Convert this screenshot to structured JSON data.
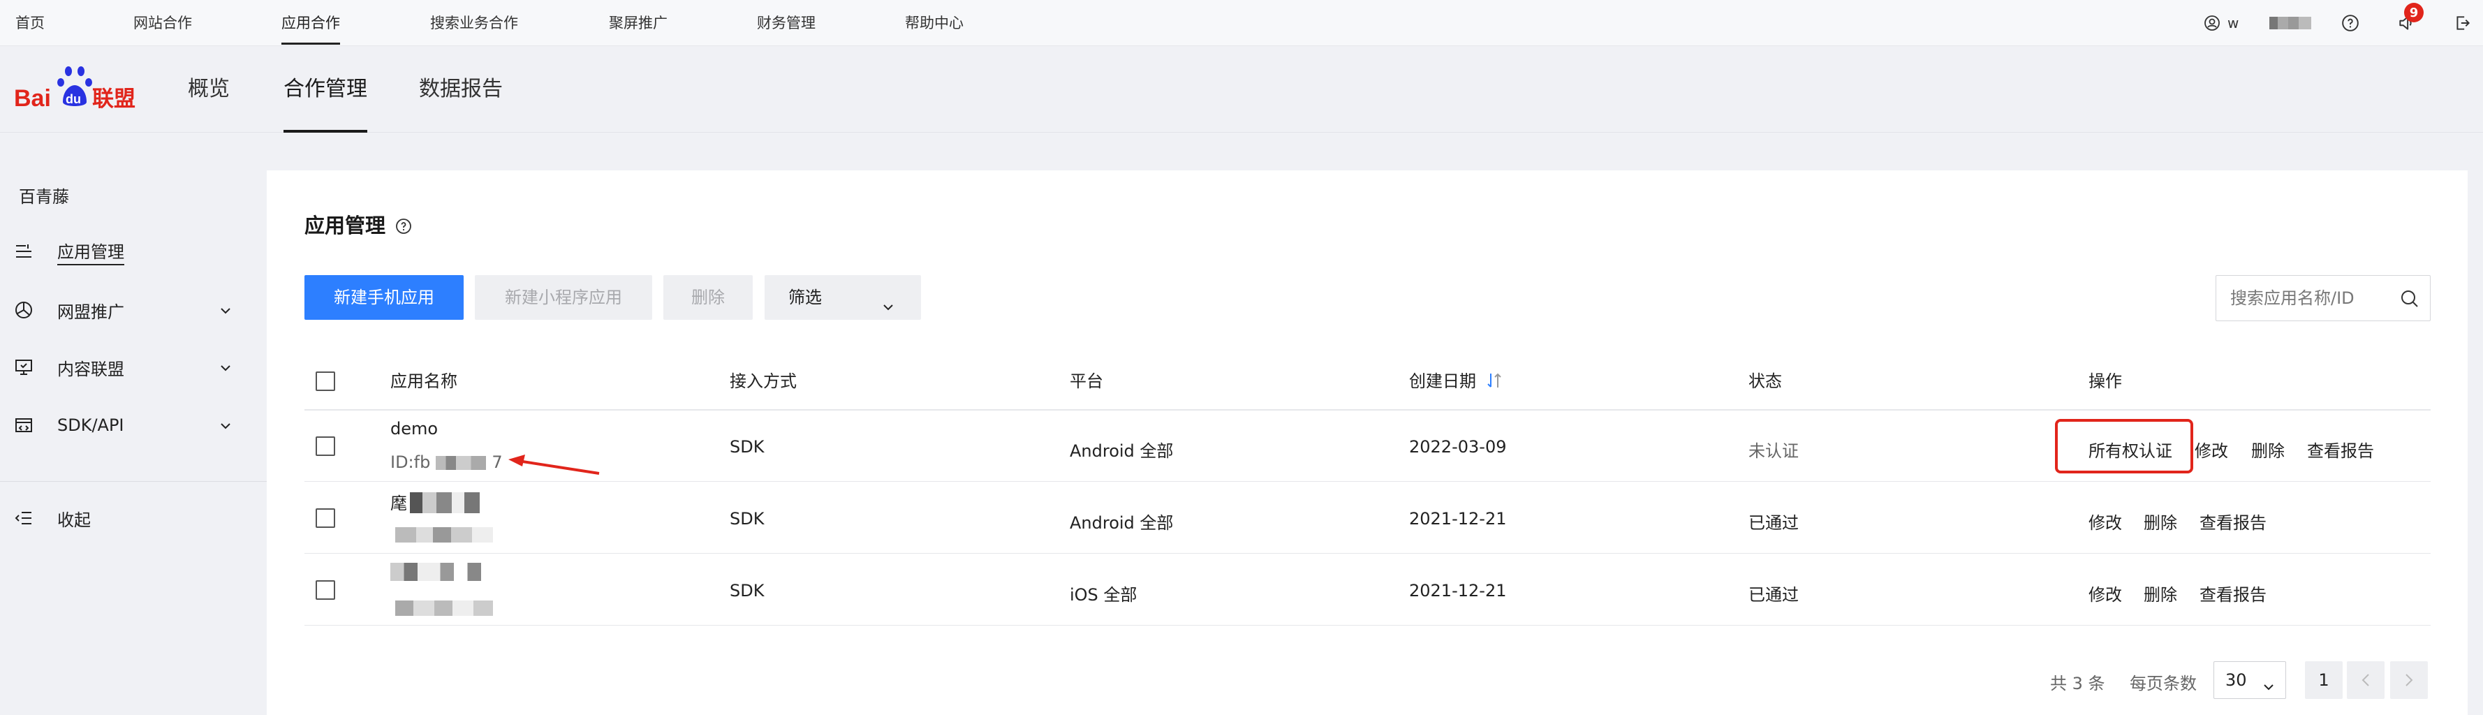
{
  "topnav": {
    "items": [
      "首页",
      "网站合作",
      "应用合作",
      "搜索业务合作",
      "聚屏推广",
      "财务管理",
      "帮助中心"
    ],
    "active_index": 2,
    "user_name": "w",
    "notification_count": "9"
  },
  "header": {
    "logo_text": "Bai du 联盟",
    "logo_bai": "Bai",
    "logo_du": "du",
    "logo_lianmeng": "联盟",
    "tabs": [
      "概览",
      "合作管理",
      "数据报告"
    ],
    "active_tab": 1
  },
  "sidebar": {
    "title": "百青藤",
    "items": [
      {
        "label": "应用管理",
        "icon": "list-icon",
        "has_chevron": false,
        "active": true
      },
      {
        "label": "网盟推广",
        "icon": "chart-icon",
        "has_chevron": true,
        "active": false
      },
      {
        "label": "内容联盟",
        "icon": "monitor-icon",
        "has_chevron": true,
        "active": false
      },
      {
        "label": "SDK/API",
        "icon": "sdk-icon",
        "has_chevron": true,
        "active": false
      }
    ],
    "collapse_label": "收起"
  },
  "main": {
    "title": "应用管理",
    "buttons": {
      "new_app": "新建手机应用",
      "new_mini": "新建小程序应用",
      "delete": "删除",
      "filter": "筛选"
    },
    "search_placeholder": "搜索应用名称/ID",
    "table": {
      "columns": [
        "应用名称",
        "接入方式",
        "平台",
        "创建日期",
        "状态",
        "操作"
      ],
      "rows": [
        {
          "name": "demo",
          "id_prefix": "ID:fb",
          "id_suffix": "7",
          "access": "SDK",
          "platform": "Android 全部",
          "date": "2022-03-09",
          "status": "未认证",
          "actions": [
            "所有权认证",
            "修改",
            "删除",
            "查看报告"
          ]
        },
        {
          "name": "麾",
          "access": "SDK",
          "platform": "Android 全部",
          "date": "2021-12-21",
          "status": "已通过",
          "actions": [
            "修改",
            "删除",
            "查看报告"
          ]
        },
        {
          "name": "",
          "access": "SDK",
          "platform": "iOS 全部",
          "date": "2021-12-21",
          "status": "已通过",
          "actions": [
            "修改",
            "删除",
            "查看报告"
          ]
        }
      ]
    },
    "pagination": {
      "total": "共 3 条",
      "per_page_label": "每页条数",
      "per_page_value": "30",
      "current_page": "1"
    }
  },
  "colors": {
    "primary": "#2d7fff",
    "annotation_red": "#e1251b",
    "baidu_red": "#e1251b",
    "baidu_blue": "#2932e1"
  }
}
